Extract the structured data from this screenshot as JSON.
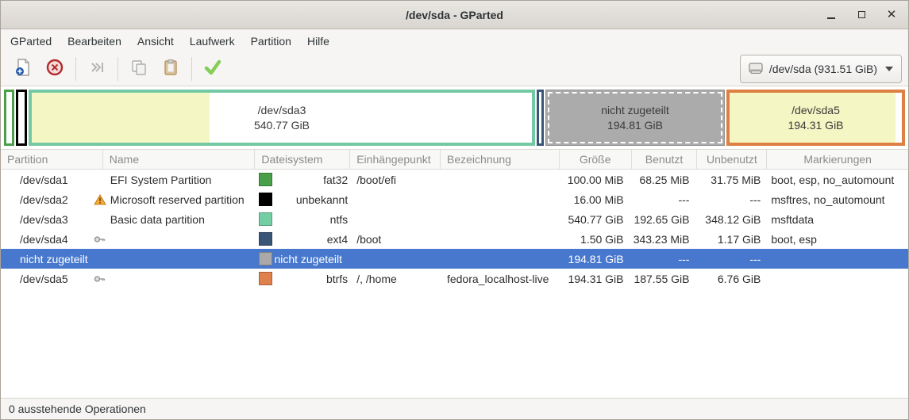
{
  "window": {
    "title": "/dev/sda - GParted"
  },
  "menu": {
    "items": [
      "GParted",
      "Bearbeiten",
      "Ansicht",
      "Laufwerk",
      "Partition",
      "Hilfe"
    ]
  },
  "toolbar": {
    "buttons": [
      "new-partition",
      "delete-partition",
      "resize-move",
      "copy",
      "paste",
      "apply-operations"
    ],
    "device_selector": "/dev/sda (931.51 GiB)"
  },
  "disk_visual": {
    "segments": [
      {
        "name": "/dev/sda1",
        "fs": "fat32"
      },
      {
        "name": "/dev/sda2",
        "fs": "unbekannt"
      },
      {
        "name": "/dev/sda3",
        "size": "540.77 GiB",
        "fs": "ntfs",
        "used_pct": 35.6
      },
      {
        "name": "/dev/sda4",
        "fs": "ext4"
      },
      {
        "name": "nicht zugeteilt",
        "size": "194.81 GiB",
        "fs": "unallocated"
      },
      {
        "name": "/dev/sda5",
        "size": "194.31 GiB",
        "fs": "btrfs",
        "used_pct": 96.5
      }
    ]
  },
  "table": {
    "columns": [
      "Partition",
      "Name",
      "Dateisystem",
      "Einhängepunkt",
      "Bezeichnung",
      "Größe",
      "Benutzt",
      "Unbenutzt",
      "Markierungen"
    ],
    "rows": [
      {
        "partition": "/dev/sda1",
        "name": "EFI System Partition",
        "fs": "fat32",
        "mount": "/boot/efi",
        "label": "",
        "size": "100.00 MiB",
        "used": "68.25 MiB",
        "unused": "31.75 MiB",
        "flags": "boot, esp, no_automount"
      },
      {
        "partition": "/dev/sda2",
        "name": "Microsoft reserved partition",
        "fs": "unbekannt",
        "mount": "",
        "label": "",
        "size": "16.00 MiB",
        "used": "---",
        "unused": "---",
        "flags": "msftres, no_automount"
      },
      {
        "partition": "/dev/sda3",
        "name": "Basic data partition",
        "fs": "ntfs",
        "mount": "",
        "label": "",
        "size": "540.77 GiB",
        "used": "192.65 GiB",
        "unused": "348.12 GiB",
        "flags": "msftdata"
      },
      {
        "partition": "/dev/sda4",
        "name": "",
        "fs": "ext4",
        "mount": "/boot",
        "label": "",
        "size": "1.50 GiB",
        "used": "343.23 MiB",
        "unused": "1.17 GiB",
        "flags": "boot, esp"
      },
      {
        "partition": "nicht zugeteilt",
        "name": "",
        "fs": "nicht zugeteilt",
        "mount": "",
        "label": "",
        "size": "194.81 GiB",
        "used": "---",
        "unused": "---",
        "flags": ""
      },
      {
        "partition": "/dev/sda5",
        "name": "",
        "fs": "btrfs",
        "mount": "/, /home",
        "label": "fedora_localhost-live",
        "size": "194.31 GiB",
        "used": "187.55 GiB",
        "unused": "6.76 GiB",
        "flags": ""
      }
    ],
    "selected_row_index": 4
  },
  "statusbar": {
    "text": "0 ausstehende Operationen"
  },
  "colors": {
    "selection_blue": "#4878cd",
    "fs_fat32": "#4aa04a",
    "fs_unknown": "#000000",
    "fs_ntfs": "#73cfa3",
    "fs_ext4": "#3a5676",
    "fs_btrfs": "#e0804d",
    "unallocated_gray": "#ababab",
    "used_space_yellow": "#f4f6c3"
  }
}
